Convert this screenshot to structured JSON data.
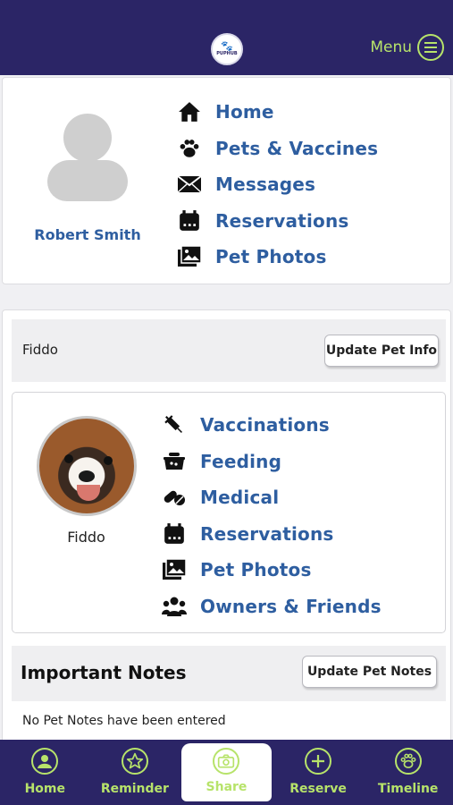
{
  "header": {
    "logo_text": "PUPHUB",
    "menu_label": "Menu"
  },
  "profile": {
    "name": "Robert Smith",
    "nav": [
      {
        "label": "Home",
        "icon": "home-icon"
      },
      {
        "label": "Pets & Vaccines",
        "icon": "paw-icon"
      },
      {
        "label": "Messages",
        "icon": "envelope-icon"
      },
      {
        "label": "Reservations",
        "icon": "calendar-icon"
      },
      {
        "label": "Pet Photos",
        "icon": "photos-icon"
      }
    ]
  },
  "pet": {
    "bar_name": "Fiddo",
    "update_info_label": "Update Pet Info",
    "card_name": "Fiddo",
    "nav": [
      {
        "label": "Vaccinations",
        "icon": "syringe-icon"
      },
      {
        "label": "Feeding",
        "icon": "food-bowl-icon"
      },
      {
        "label": "Medical",
        "icon": "pills-icon"
      },
      {
        "label": "Reservations",
        "icon": "calendar-icon"
      },
      {
        "label": "Pet Photos",
        "icon": "photos-icon"
      },
      {
        "label": "Owners & Friends",
        "icon": "users-icon"
      }
    ]
  },
  "notes": {
    "title": "Important Notes",
    "update_label": "Update Pet Notes",
    "empty_text": "No Pet Notes have been entered"
  },
  "tabbar": {
    "tabs": [
      {
        "label": "Home",
        "icon": "user-circle-icon"
      },
      {
        "label": "Reminder",
        "icon": "star-icon"
      },
      {
        "label": "Share",
        "icon": "camera-icon"
      },
      {
        "label": "Reserve",
        "icon": "plus-icon"
      },
      {
        "label": "Timeline",
        "icon": "paw-icon"
      }
    ]
  },
  "colors": {
    "header_bg": "#2b2566",
    "accent_green": "#b7e36a",
    "link_blue": "#2e5ea0"
  }
}
